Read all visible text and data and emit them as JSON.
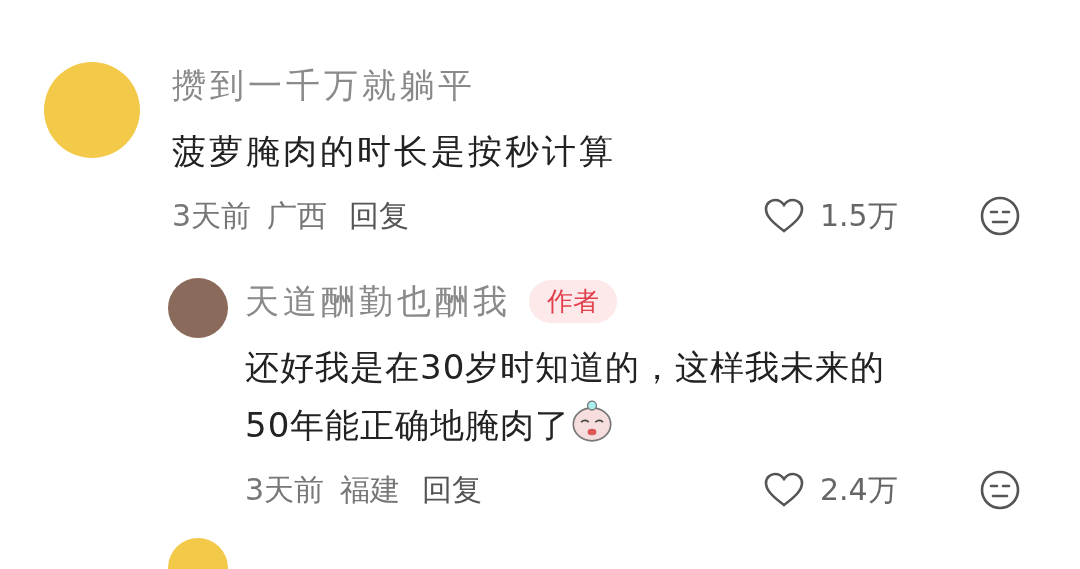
{
  "comments": [
    {
      "username": "攒到一千万就躺平",
      "text": "菠萝腌肉的时长是按秒计算",
      "time": "3天前",
      "location": "广西",
      "reply_label": "回复",
      "likes": "1.5万",
      "replies": [
        {
          "username": "天道酬勤也酬我",
          "author_badge": "作者",
          "text_lines": [
            "还好我是在30岁时知道的，这样我未来的",
            "50年能正确地腌肉了"
          ],
          "time": "3天前",
          "location": "福建",
          "reply_label": "回复",
          "likes": "2.4万"
        }
      ]
    }
  ]
}
